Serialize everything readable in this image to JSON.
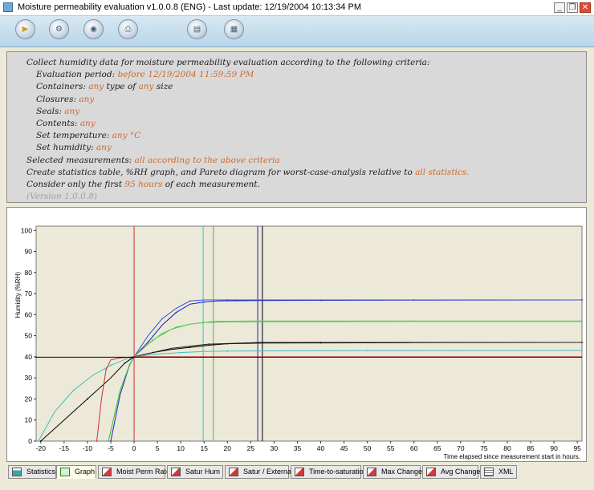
{
  "window": {
    "title": "Moisture permeability evaluation v1.0.0.8 (ENG) - Last update: 12/19/2004 10:13:34 PM",
    "minimize": "_",
    "restore": "❐",
    "close": "✕"
  },
  "toolbar": {
    "buttons": [
      {
        "name": "run-icon"
      },
      {
        "name": "settings-icon"
      },
      {
        "name": "preview-icon"
      },
      {
        "name": "print-icon"
      },
      {
        "name": "export-icon"
      },
      {
        "name": "report-icon"
      }
    ]
  },
  "criteria": {
    "line1": "Collect humidity data for moisture permeability evaluation according to the following criteria:",
    "period_label": "Evaluation period:",
    "period_value": "before 12/19/2004 11:59:59 PM",
    "containers_label": "Containers:",
    "containers_any1": "any",
    "containers_mid": "type of",
    "containers_any2": "any",
    "containers_end": "size",
    "closures_label": "Closures:",
    "closures_value": "any",
    "seals_label": "Seals:",
    "seals_value": "any",
    "contents_label": "Contents:",
    "contents_value": "any",
    "temp_label": "Set temperature:",
    "temp_value": "any °C",
    "humidity_label": "Set humidity:",
    "humidity_value": "any",
    "selected_label": "Selected measurements:",
    "selected_value": "all according to the above criteria",
    "create_text": "Create statistics table, %RH graph, and Pareto diagram for worst-case-analysis relative to",
    "create_value": "all statistics.",
    "consider_pre": "Consider only the first",
    "consider_value": "95 hours",
    "consider_post": "of each measurement.",
    "version": "(Version 1.0.0.8)"
  },
  "chart_data": {
    "type": "line",
    "xlabel": "Time elapsed since measurement start in hours.",
    "ylabel": "Humidity (%RH)",
    "xlim": [
      -21,
      96
    ],
    "ylim": [
      0,
      102
    ],
    "xticks": [
      -20,
      -15,
      -10,
      -5,
      0,
      5,
      10,
      15,
      20,
      25,
      30,
      35,
      40,
      45,
      50,
      55,
      60,
      65,
      70,
      75,
      80,
      85,
      90,
      95
    ],
    "yticks": [
      0,
      10,
      20,
      30,
      40,
      50,
      60,
      70,
      80,
      90,
      100
    ],
    "vlines": [
      {
        "x": 0,
        "color": "#d03030"
      },
      {
        "x": 14.8,
        "color": "#40c0c0"
      },
      {
        "x": 17,
        "color": "#40c040"
      },
      {
        "x": 26.5,
        "color": "#2020c0"
      },
      {
        "x": 27.5,
        "color": "#000000"
      }
    ],
    "series": [
      {
        "color": "#2020c0",
        "x": [
          -5,
          -3,
          -1,
          0,
          3,
          6,
          9,
          12,
          15,
          18,
          22,
          27,
          40,
          60,
          96
        ],
        "y": [
          0,
          22,
          36,
          40,
          47,
          55,
          61,
          65,
          66,
          66.5,
          66.6,
          66.7,
          66.8,
          66.9,
          67
        ]
      },
      {
        "color": "#3050e0",
        "x": [
          0,
          3,
          6,
          9,
          12,
          15,
          20,
          30,
          60,
          96
        ],
        "y": [
          40,
          50,
          58,
          63,
          66.5,
          67,
          67,
          67,
          67,
          67
        ]
      },
      {
        "color": "#30c030",
        "x": [
          -5.5,
          -3,
          -1,
          0,
          3,
          6,
          9,
          12,
          15,
          20,
          30,
          60,
          96
        ],
        "y": [
          0,
          24,
          36,
          40,
          46,
          51,
          54,
          55.5,
          56.3,
          56.6,
          56.7,
          56.8,
          56.8
        ]
      },
      {
        "color": "#60d060",
        "x": [
          0,
          4,
          8,
          12,
          17,
          25,
          60,
          96
        ],
        "y": [
          40,
          48,
          53,
          55.5,
          56.8,
          57,
          57,
          57
        ]
      },
      {
        "color": "#000000",
        "x": [
          -20,
          -15,
          -10,
          -5,
          -2,
          0,
          4,
          8,
          12,
          16,
          20,
          28,
          40,
          60,
          96
        ],
        "y": [
          0,
          10,
          20,
          30,
          37,
          40,
          42,
          43.5,
          44.5,
          45.5,
          46.2,
          46.5,
          46.6,
          46.7,
          46.8
        ]
      },
      {
        "color": "#202020",
        "x": [
          0,
          8,
          16,
          27,
          40,
          96
        ],
        "y": [
          40,
          44,
          46,
          46.8,
          46.8,
          46.8
        ]
      },
      {
        "color": "#40c0c0",
        "x": [
          -20.5,
          -17,
          -13,
          -9,
          -5,
          -2,
          0,
          5,
          10,
          15,
          20,
          30,
          50,
          96
        ],
        "y": [
          0,
          14,
          24,
          31,
          36,
          38.7,
          40,
          41.3,
          42,
          42.5,
          42.7,
          42.8,
          42.9,
          43
        ]
      },
      {
        "color": "#d03030",
        "x": [
          -8,
          -7,
          -6,
          -5,
          -3,
          -1,
          0,
          96
        ],
        "y": [
          0,
          20,
          34,
          38.5,
          39.5,
          39.8,
          40,
          40
        ]
      },
      {
        "color": "#000000",
        "x": [
          -21,
          96
        ],
        "y": [
          39.8,
          39.8
        ]
      }
    ]
  },
  "tabs": [
    {
      "label": "Statistics",
      "icon": "teal"
    },
    {
      "label": "Graph",
      "icon": "green"
    },
    {
      "label": "Moist Perm Rate",
      "icon": "red"
    },
    {
      "label": "Satur Hum",
      "icon": "red"
    },
    {
      "label": "Satur / External",
      "icon": "red"
    },
    {
      "label": "Time-to-saturation",
      "icon": "red"
    },
    {
      "label": "Max Change",
      "icon": "red"
    },
    {
      "label": "Avg Change",
      "icon": "red"
    },
    {
      "label": "XML",
      "icon": "doc"
    }
  ]
}
